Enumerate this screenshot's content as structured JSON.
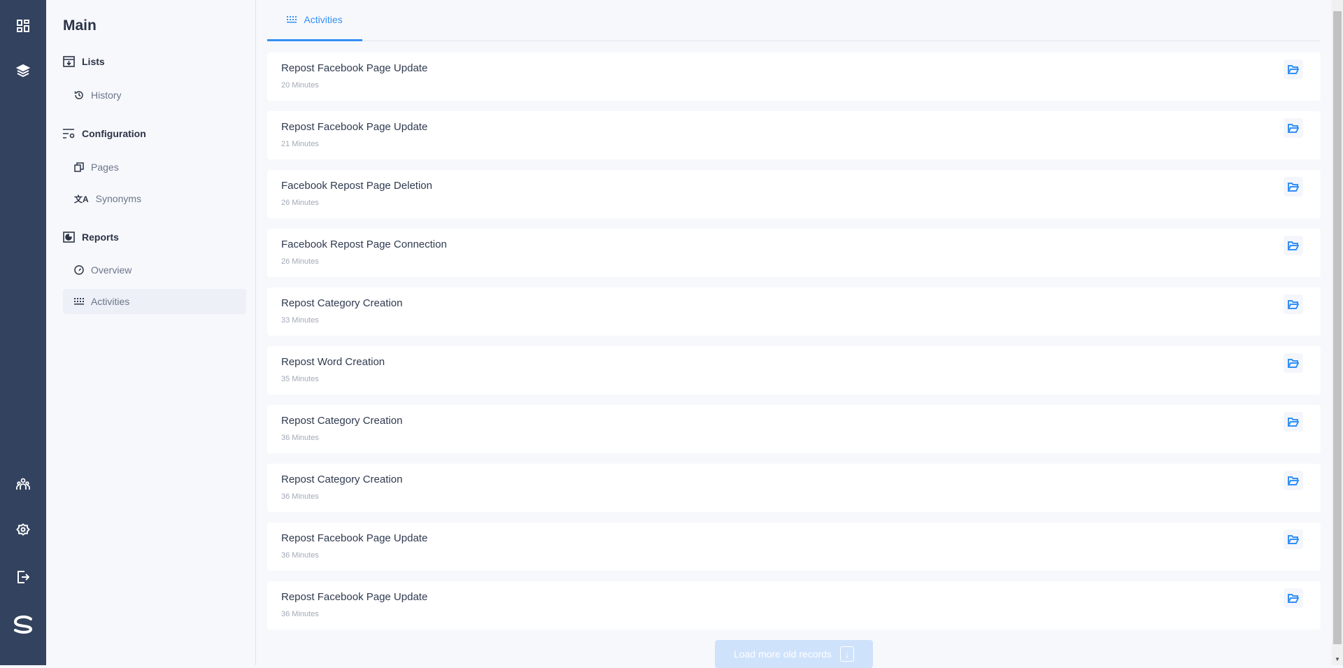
{
  "rail": {
    "icons": [
      "dashboard-icon",
      "layers-icon",
      "users-icon",
      "settings-icon",
      "logout-icon",
      "logo-icon"
    ]
  },
  "sidebar": {
    "title": "Main",
    "sections": [
      {
        "label": "Lists",
        "items": [
          {
            "label": "History"
          }
        ]
      },
      {
        "label": "Configuration",
        "items": [
          {
            "label": "Pages"
          },
          {
            "label": "Synonyms"
          }
        ]
      },
      {
        "label": "Reports",
        "items": [
          {
            "label": "Overview"
          },
          {
            "label": "Activities",
            "active": true
          }
        ]
      }
    ]
  },
  "tab": {
    "label": "Activities"
  },
  "activities": [
    {
      "title": "Repost Facebook Page Update",
      "time": "20 Minutes"
    },
    {
      "title": "Repost Facebook Page Update",
      "time": "21 Minutes"
    },
    {
      "title": "Facebook Repost Page Deletion",
      "time": "26 Minutes"
    },
    {
      "title": "Facebook Repost Page Connection",
      "time": "26 Minutes"
    },
    {
      "title": "Repost Category Creation",
      "time": "33 Minutes"
    },
    {
      "title": "Repost Word Creation",
      "time": "35 Minutes"
    },
    {
      "title": "Repost Category Creation",
      "time": "36 Minutes"
    },
    {
      "title": "Repost Category Creation",
      "time": "36 Minutes"
    },
    {
      "title": "Repost Facebook Page Update",
      "time": "36 Minutes"
    },
    {
      "title": "Repost Facebook Page Update",
      "time": "36 Minutes"
    }
  ],
  "load_more": {
    "label": "Load more old records"
  },
  "colors": {
    "rail": "#33425e",
    "accent": "#3390f5"
  }
}
